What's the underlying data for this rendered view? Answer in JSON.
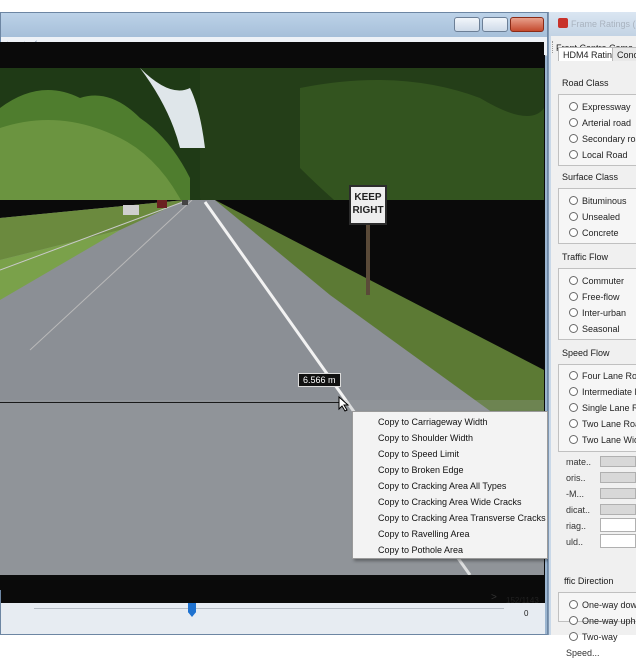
{
  "video": {
    "sign_text_1": "KEEP",
    "sign_text_2": "RIGHT",
    "measurement": "6.566 m",
    "frame_counter": "152/1143",
    "frame_sub": "0",
    "next_glyph": ">"
  },
  "context_menu": {
    "items": [
      "Copy to Carriageway Width",
      "Copy to Shoulder Width",
      "Copy to Speed Limit",
      "Copy to Broken Edge",
      "Copy to Cracking Area All Types",
      "Copy to Cracking Area Wide Cracks",
      "Copy to Cracking Area Transverse Cracks",
      "Copy to Ravelling Area",
      "Copy to Pothole Area"
    ]
  },
  "ratings": {
    "window_title": "Frame Ratings (F",
    "camera": "Front Centre Came",
    "tabs": [
      "HDM4 Rating",
      "Conc"
    ],
    "road_class": {
      "label": "Road Class",
      "options": [
        "Expressway",
        "Arterial road",
        "Secondary road",
        "Local Road"
      ]
    },
    "surface_class": {
      "label": "Surface Class",
      "options": [
        "Bituminous",
        "Unsealed",
        "Concrete"
      ]
    },
    "traffic_flow": {
      "label": "Traffic Flow",
      "options": [
        "Commuter",
        "Free-flow",
        "Inter-urban",
        "Seasonal"
      ]
    },
    "speed_flow": {
      "label": "Speed Flow",
      "options": [
        "Four Lane Road",
        "Intermediate Ro",
        "Single Lane Ro",
        "Two Lane Road",
        "Two Lane Wide"
      ]
    },
    "fields": [
      "mate..",
      "oris..",
      "-M...",
      "dicat..",
      "riag..",
      "uld.."
    ],
    "traffic_direction": {
      "label": "ffic Direction",
      "options": [
        "One-way downhi",
        "One-way uphill",
        "Two-way"
      ]
    },
    "speed_label": "Speed..."
  }
}
